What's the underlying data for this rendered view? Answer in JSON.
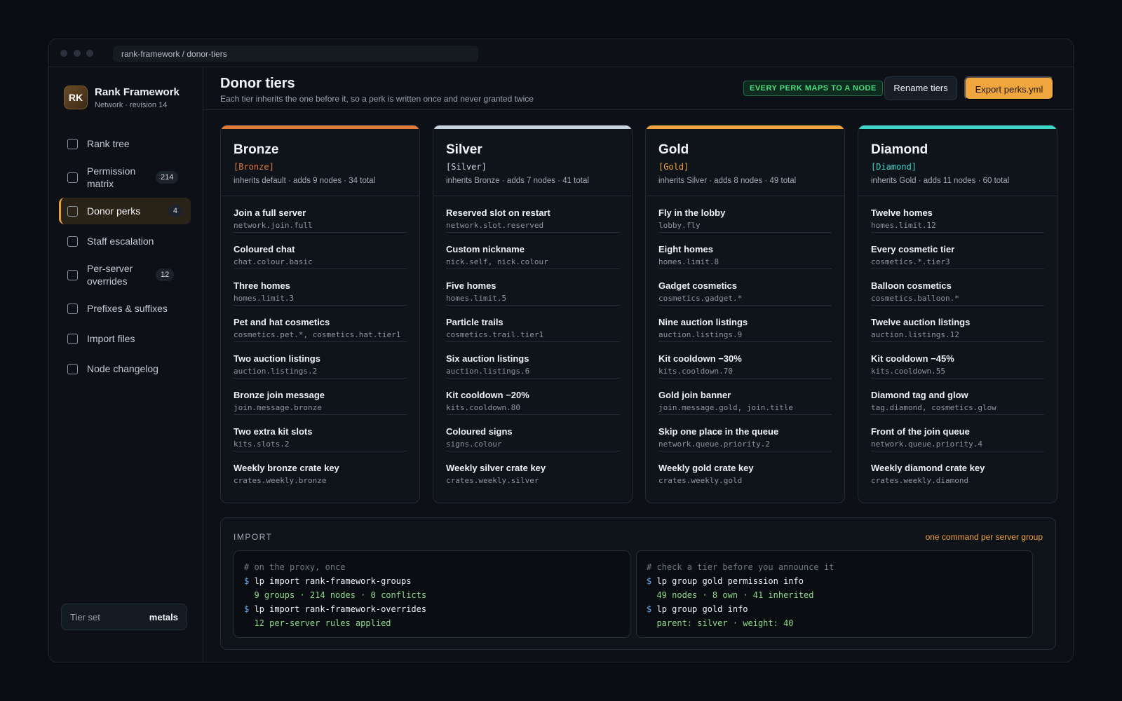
{
  "window": {
    "address": "rank-framework / donor-tiers"
  },
  "sidebar": {
    "brand_initials": "RK",
    "brand_title": "Rank Framework",
    "brand_sub": "Network · revision 14",
    "items": [
      {
        "label": "Rank tree",
        "badge": ""
      },
      {
        "label": "Permission matrix",
        "badge": "214"
      },
      {
        "label": "Donor perks",
        "badge": "4"
      },
      {
        "label": "Staff escalation",
        "badge": ""
      },
      {
        "label": "Per-server overrides",
        "badge": "12"
      },
      {
        "label": "Prefixes & suffixes",
        "badge": ""
      },
      {
        "label": "Import files",
        "badge": ""
      },
      {
        "label": "Node changelog",
        "badge": ""
      }
    ],
    "tierset_label": "Tier set",
    "tierset_value": "metals"
  },
  "header": {
    "title": "Donor tiers",
    "subtitle": "Each tier inherits the one before it, so a perk is written once and never granted twice",
    "pill": "EVERY PERK MAPS TO A NODE",
    "rename_label": "Rename tiers",
    "export_label": "Export perks.yml"
  },
  "colors": {
    "bronze": "#e07b3c",
    "silver": "#c9d3df",
    "gold": "#f0a53e",
    "diamond": "#3fd6c8",
    "accent": "#f0a53e"
  },
  "tiers": [
    {
      "name": "Bronze",
      "tag": "[Bronze]",
      "info": "inherits default · adds 9 nodes · 34 total",
      "perks": [
        {
          "title": "Join a full server",
          "node": "network.join.full"
        },
        {
          "title": "Coloured chat",
          "node": "chat.colour.basic"
        },
        {
          "title": "Three homes",
          "node": "homes.limit.3"
        },
        {
          "title": "Pet and hat cosmetics",
          "node": "cosmetics.pet.*, cosmetics.hat.tier1"
        },
        {
          "title": "Two auction listings",
          "node": "auction.listings.2"
        },
        {
          "title": "Bronze join message",
          "node": "join.message.bronze"
        },
        {
          "title": "Two extra kit slots",
          "node": "kits.slots.2"
        },
        {
          "title": "Weekly bronze crate key",
          "node": "crates.weekly.bronze"
        }
      ]
    },
    {
      "name": "Silver",
      "tag": "[Silver]",
      "info": "inherits Bronze · adds 7 nodes · 41 total",
      "perks": [
        {
          "title": "Reserved slot on restart",
          "node": "network.slot.reserved"
        },
        {
          "title": "Custom nickname",
          "node": "nick.self, nick.colour"
        },
        {
          "title": "Five homes",
          "node": "homes.limit.5"
        },
        {
          "title": "Particle trails",
          "node": "cosmetics.trail.tier1"
        },
        {
          "title": "Six auction listings",
          "node": "auction.listings.6"
        },
        {
          "title": "Kit cooldown −20%",
          "node": "kits.cooldown.80"
        },
        {
          "title": "Coloured signs",
          "node": "signs.colour"
        },
        {
          "title": "Weekly silver crate key",
          "node": "crates.weekly.silver"
        }
      ]
    },
    {
      "name": "Gold",
      "tag": "[Gold]",
      "info": "inherits Silver · adds 8 nodes · 49 total",
      "perks": [
        {
          "title": "Fly in the lobby",
          "node": "lobby.fly"
        },
        {
          "title": "Eight homes",
          "node": "homes.limit.8"
        },
        {
          "title": "Gadget cosmetics",
          "node": "cosmetics.gadget.*"
        },
        {
          "title": "Nine auction listings",
          "node": "auction.listings.9"
        },
        {
          "title": "Kit cooldown −30%",
          "node": "kits.cooldown.70"
        },
        {
          "title": "Gold join banner",
          "node": "join.message.gold, join.title"
        },
        {
          "title": "Skip one place in the queue",
          "node": "network.queue.priority.2"
        },
        {
          "title": "Weekly gold crate key",
          "node": "crates.weekly.gold"
        }
      ]
    },
    {
      "name": "Diamond",
      "tag": "[Diamond]",
      "info": "inherits Gold · adds 11 nodes · 60 total",
      "perks": [
        {
          "title": "Twelve homes",
          "node": "homes.limit.12"
        },
        {
          "title": "Every cosmetic tier",
          "node": "cosmetics.*.tier3"
        },
        {
          "title": "Balloon cosmetics",
          "node": "cosmetics.balloon.*"
        },
        {
          "title": "Twelve auction listings",
          "node": "auction.listings.12"
        },
        {
          "title": "Kit cooldown −45%",
          "node": "kits.cooldown.55"
        },
        {
          "title": "Diamond tag and glow",
          "node": "tag.diamond, cosmetics.glow"
        },
        {
          "title": "Front of the join queue",
          "node": "network.queue.priority.4"
        },
        {
          "title": "Weekly diamond crate key",
          "node": "crates.weekly.diamond"
        }
      ]
    }
  ],
  "import": {
    "title": "IMPORT",
    "note": "one command per server group",
    "terminals": [
      [
        {
          "kind": "comment",
          "text": "# on the proxy, once"
        },
        {
          "kind": "cmd",
          "text": "lp import rank-framework-groups"
        },
        {
          "kind": "out",
          "text": "  9 groups · 214 nodes · 0 conflicts"
        },
        {
          "kind": "cmd",
          "text": "lp import rank-framework-overrides"
        },
        {
          "kind": "out",
          "text": "  12 per-server rules applied"
        }
      ],
      [
        {
          "kind": "comment",
          "text": "# check a tier before you announce it"
        },
        {
          "kind": "cmd",
          "text": "lp group gold permission info"
        },
        {
          "kind": "out",
          "text": "  49 nodes · 8 own · 41 inherited"
        },
        {
          "kind": "cmd",
          "text": "lp group gold info"
        },
        {
          "kind": "out",
          "text": "  parent: silver · weight: 40"
        }
      ]
    ],
    "prompt": "$"
  }
}
